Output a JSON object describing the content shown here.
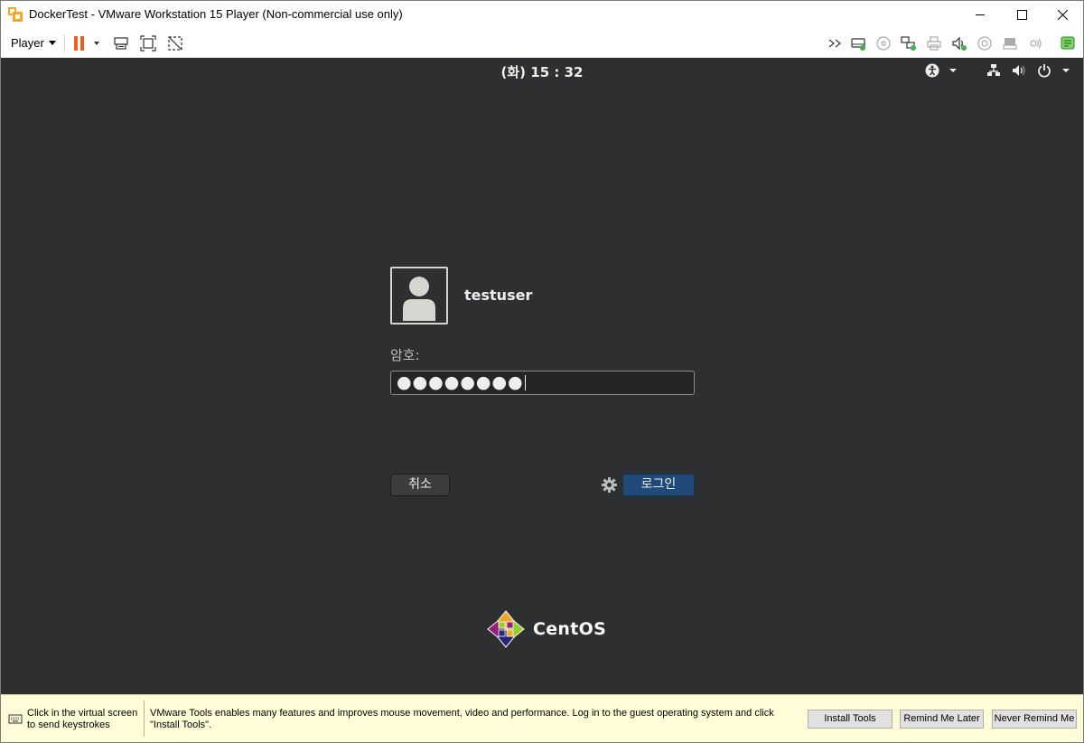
{
  "window": {
    "title": "DockerTest - VMware Workstation 15 Player (Non-commercial use only)"
  },
  "toolbar": {
    "player_label": "Player",
    "icons": [
      "pause-icon",
      "send-ctrl-alt-del-icon",
      "full-screen-icon",
      "unity-icon",
      "more-icon",
      "hard-disk-icon",
      "cd-dvd-icon",
      "network-icon",
      "printer-icon",
      "sound-icon",
      "floppy-icon",
      "usb-printer-icon",
      "microphone-icon",
      "message-log-icon"
    ],
    "accent_color": "#e8641c"
  },
  "vm": {
    "clock": "(화) 15 : 32",
    "username": "testuser",
    "password_label": "암호:",
    "password_mask": "●●●●●●●●",
    "cancel_label": "취소",
    "login_label": "로그인",
    "os_brand": "CentOS"
  },
  "notification": {
    "click_hint": "Click in the virtual screen to send keystrokes",
    "tools_message": "VMware Tools enables many features and improves mouse movement, video and performance. Log in to the guest operating system and click \"Install Tools\".",
    "install_label": "Install Tools",
    "remind_label": "Remind Me Later",
    "never_label": "Never Remind Me"
  }
}
